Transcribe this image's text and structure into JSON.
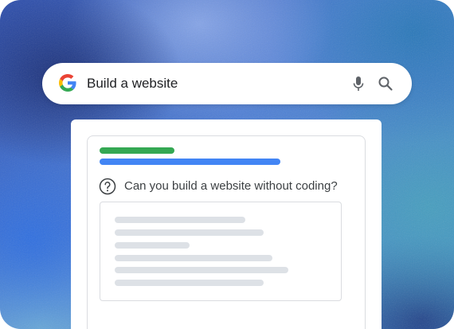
{
  "search": {
    "query": "Build a website",
    "logo_icon": "google-g-logo-icon",
    "mic_icon": "microphone-icon",
    "search_icon": "magnifier-icon"
  },
  "result": {
    "question": "Can you build a website without coding?",
    "help_icon": "question-circle-icon",
    "accent_green": "#34a853",
    "accent_blue": "#4285f4",
    "placeholder_line_color": "#dde1e6"
  }
}
